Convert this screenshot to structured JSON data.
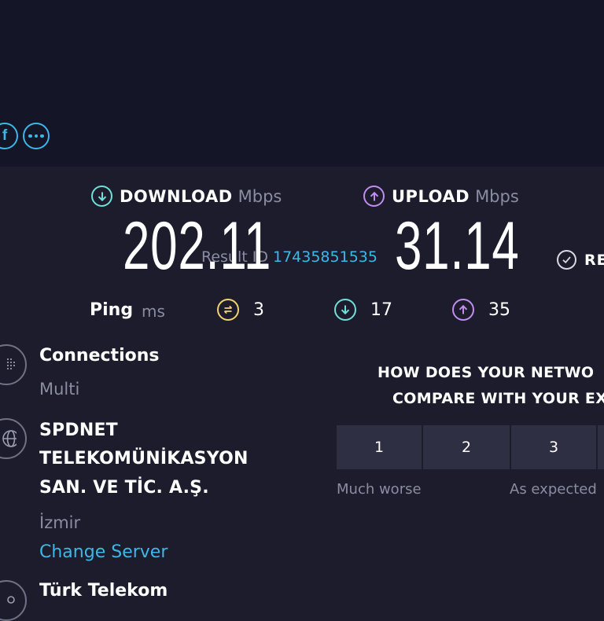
{
  "header": {
    "result_id_label": "Result ID",
    "result_id_value": "17435851535",
    "results_button_label": "RE",
    "share_icons": [
      "facebook-icon",
      "more-options-icon"
    ]
  },
  "metrics": {
    "download": {
      "title": "DOWNLOAD",
      "unit": "Mbps",
      "value": "202.11",
      "color": "#6fe0d8"
    },
    "upload": {
      "title": "UPLOAD",
      "unit": "Mbps",
      "value": "31.14",
      "color": "#c28cf0"
    }
  },
  "ping": {
    "label": "Ping",
    "unit": "ms",
    "idle": "3",
    "download": "17",
    "upload": "35",
    "idle_color": "#f0d36e"
  },
  "connections": {
    "title": "Connections",
    "value": "Multi"
  },
  "server": {
    "name_lines": [
      "SPDNET",
      "TELEKOMÜNİKASYON",
      "SAN. VE TİC. A.Ş."
    ],
    "location": "İzmir",
    "change_link": "Change Server"
  },
  "provider": {
    "name": "Türk Telekom"
  },
  "feedback": {
    "question_line1": "HOW DOES YOUR NETWO",
    "question_line2": "COMPARE WITH YOUR EX",
    "options": [
      "1",
      "2",
      "3"
    ],
    "scale_low": "Much worse",
    "scale_mid": "As expected"
  },
  "colors": {
    "accent": "#3cb8e8",
    "background": "#1c1c2c",
    "header_bg": "#141526"
  }
}
